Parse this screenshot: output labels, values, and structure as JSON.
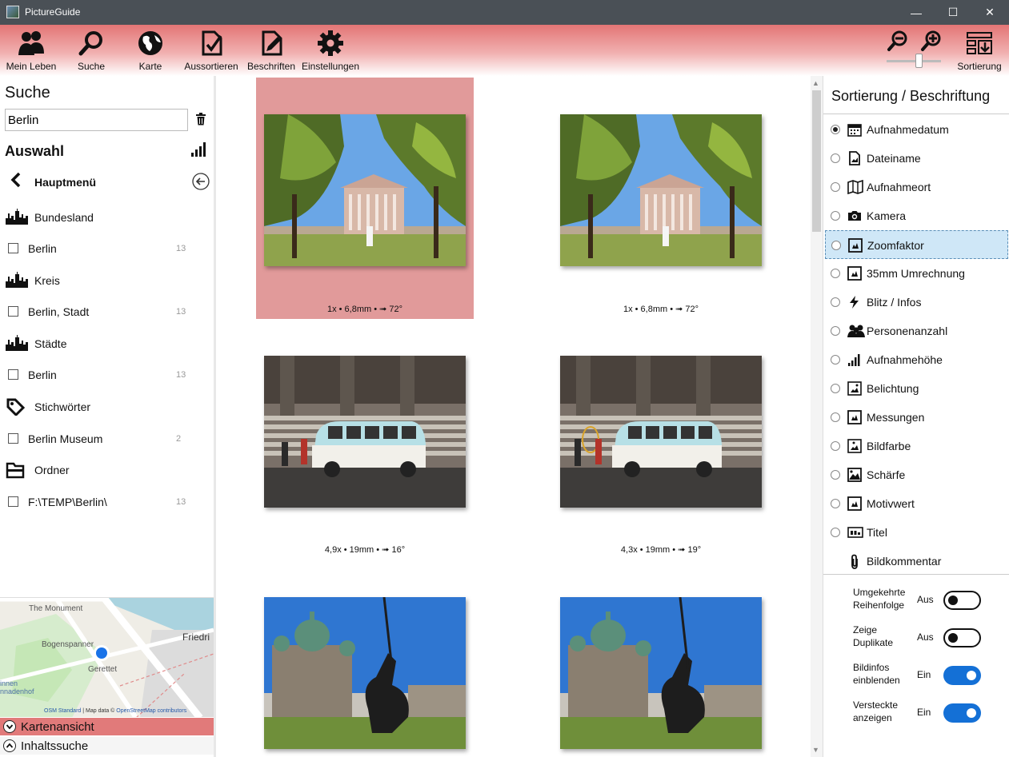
{
  "window": {
    "title": "PictureGuide",
    "minimize_glyph": "—",
    "maximize_glyph": "☐",
    "close_glyph": "✕"
  },
  "toolbar": {
    "buttons": [
      {
        "label": "Mein Leben",
        "icon": "people-icon"
      },
      {
        "label": "Suche",
        "icon": "search-icon"
      },
      {
        "label": "Karte",
        "icon": "globe-icon"
      },
      {
        "label": "Aussortieren",
        "icon": "document-check-icon"
      },
      {
        "label": "Beschriften",
        "icon": "document-edit-icon"
      },
      {
        "label": "Einstellungen",
        "icon": "gear-icon"
      }
    ],
    "sort_label": "Sortierung",
    "zoom_level": 0.55
  },
  "left": {
    "search_heading": "Suche",
    "search_value": "Berlin",
    "selection_heading": "Auswahl",
    "main_menu_label": "Hauptmenü",
    "groups": [
      {
        "label": "Bundesland",
        "icon": "skyline-icon",
        "items": [
          {
            "label": "Berlin",
            "count": "13"
          }
        ]
      },
      {
        "label": "Kreis",
        "icon": "skyline-icon",
        "items": [
          {
            "label": "Berlin, Stadt",
            "count": "13"
          }
        ]
      },
      {
        "label": "Städte",
        "icon": "skyline-icon",
        "items": [
          {
            "label": "Berlin",
            "count": "13"
          }
        ]
      },
      {
        "label": "Stichwörter",
        "icon": "tag-icon",
        "items": [
          {
            "label": "Berlin Museum",
            "count": "2"
          }
        ]
      },
      {
        "label": "Ordner",
        "icon": "folder-icon",
        "items": [
          {
            "label": "F:\\TEMP\\Berlin\\",
            "count": "13"
          }
        ]
      }
    ],
    "map": {
      "labels": [
        "The Monument",
        "Bogenspanner",
        "Gerettet",
        "Friedri",
        "innen",
        "nnadenhof"
      ],
      "attribution_link": "OSM Standard",
      "attribution_text": " | Map data © ",
      "attribution_link2": "OpenStreetMap contributors"
    },
    "map_button": "Kartenansicht",
    "content_button": "Inhaltssuche"
  },
  "grid": {
    "photos": [
      {
        "caption": "1x • 6,8mm • ➟ 72°",
        "scene": "museum",
        "selected": true
      },
      {
        "caption": "1x • 6,8mm • ➟ 72°",
        "scene": "museum",
        "selected": false
      },
      {
        "caption": "4,9x • 19mm • ➟ 16°",
        "scene": "vwbus",
        "selected": false
      },
      {
        "caption": "4,3x • 19mm • ➟ 19°",
        "scene": "vwbus",
        "selected": false
      },
      {
        "caption": "",
        "scene": "cathedral",
        "selected": false
      },
      {
        "caption": "",
        "scene": "cathedral",
        "selected": false
      }
    ]
  },
  "right": {
    "heading": "Sortierung / Beschriftung",
    "sort_options": [
      {
        "label": "Aufnahmedatum",
        "icon": "calendar-icon",
        "checked": true,
        "selected": false
      },
      {
        "label": "Dateiname",
        "icon": "file-image-icon",
        "checked": false,
        "selected": false
      },
      {
        "label": "Aufnahmeort",
        "icon": "map-icon",
        "checked": false,
        "selected": false
      },
      {
        "label": "Kamera",
        "icon": "camera-icon",
        "checked": false,
        "selected": false
      },
      {
        "label": "Zoomfaktor",
        "icon": "zoom-frame-icon",
        "checked": false,
        "selected": true
      },
      {
        "label": "35mm Umrechnung",
        "icon": "zoom-frame-icon",
        "checked": false,
        "selected": false
      },
      {
        "label": "Blitz / Infos",
        "icon": "flash-icon",
        "checked": false,
        "selected": false
      },
      {
        "label": "Personenanzahl",
        "icon": "people-icon",
        "checked": false,
        "selected": false
      },
      {
        "label": "Aufnahmehöhe",
        "icon": "signal-bars-icon",
        "checked": false,
        "selected": false
      },
      {
        "label": "Belichtung",
        "icon": "exposure-icon",
        "checked": false,
        "selected": false
      },
      {
        "label": "Messungen",
        "icon": "metering-icon",
        "checked": false,
        "selected": false
      },
      {
        "label": "Bildfarbe",
        "icon": "color-icon",
        "checked": false,
        "selected": false
      },
      {
        "label": "Schärfe",
        "icon": "sharpness-icon",
        "checked": false,
        "selected": false
      },
      {
        "label": "Motivwert",
        "icon": "rating-icon",
        "checked": false,
        "selected": false
      },
      {
        "label": "Titel",
        "icon": "title-icon",
        "checked": false,
        "selected": false
      },
      {
        "label": "Bildkommentar",
        "icon": "paperclip-icon",
        "checked": null,
        "selected": false
      }
    ],
    "toggles": [
      {
        "label": "Umgekehrte Reihenfolge",
        "state": "Aus",
        "on": false
      },
      {
        "label": "Zeige Duplikate",
        "state": "Aus",
        "on": false
      },
      {
        "label": "Bildinfos einblenden",
        "state": "Ein",
        "on": true
      },
      {
        "label": "Versteckte anzeigen",
        "state": "Ein",
        "on": true
      }
    ]
  },
  "colors": {
    "toolbar_accent": "#e37575",
    "selection": "#e19a9a",
    "toggle_on": "#1470d6",
    "highlight": "#cfe7f7"
  }
}
